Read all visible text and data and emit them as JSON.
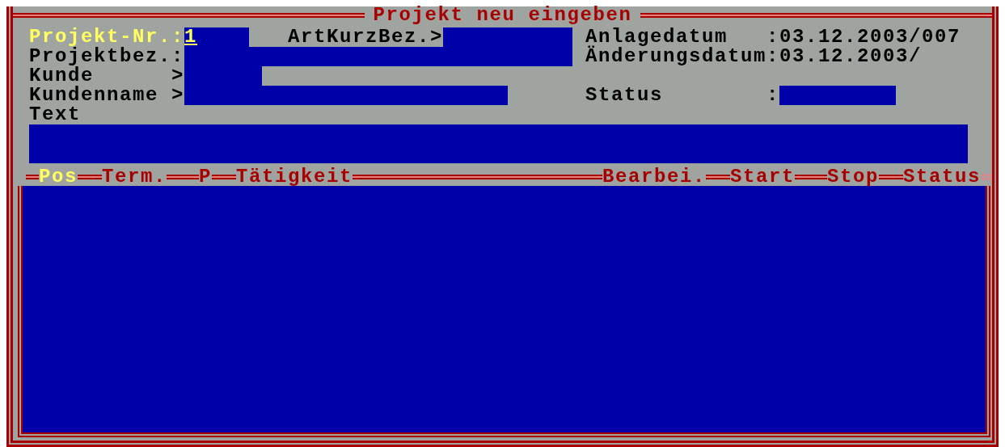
{
  "window": {
    "title": "Projekt neu eingeben"
  },
  "project_no": {
    "label": "Projekt-Nr.:",
    "value": "1",
    "focused": true
  },
  "art_kurz_bez": {
    "label": "ArtKurzBez.>"
  },
  "project_name": {
    "label": "Projektbez.:"
  },
  "customer": {
    "label": "Kunde",
    "marker": ">"
  },
  "customer_name": {
    "label": "Kundenname",
    "marker": ">"
  },
  "text": {
    "label": "Text"
  },
  "created": {
    "label": "Anlagedatum",
    "separator": ":",
    "value": "03.12.2003/007"
  },
  "changed": {
    "label": "Änderungsdatum",
    "separator": ":",
    "value": "03.12.2003/"
  },
  "status": {
    "label": "Status",
    "separator": ":"
  },
  "positions": {
    "columns_left": [
      {
        "label": "Pos",
        "selected": true
      },
      {
        "label": "Term.",
        "selected": false
      },
      {
        "label": "P",
        "selected": false
      },
      {
        "label": "Tätigkeit",
        "selected": false
      }
    ],
    "columns_right": [
      {
        "label": "Bearbei.",
        "selected": false
      },
      {
        "label": "Start",
        "selected": false
      },
      {
        "label": "Stop",
        "selected": false
      },
      {
        "label": "Status",
        "selected": false
      }
    ]
  }
}
